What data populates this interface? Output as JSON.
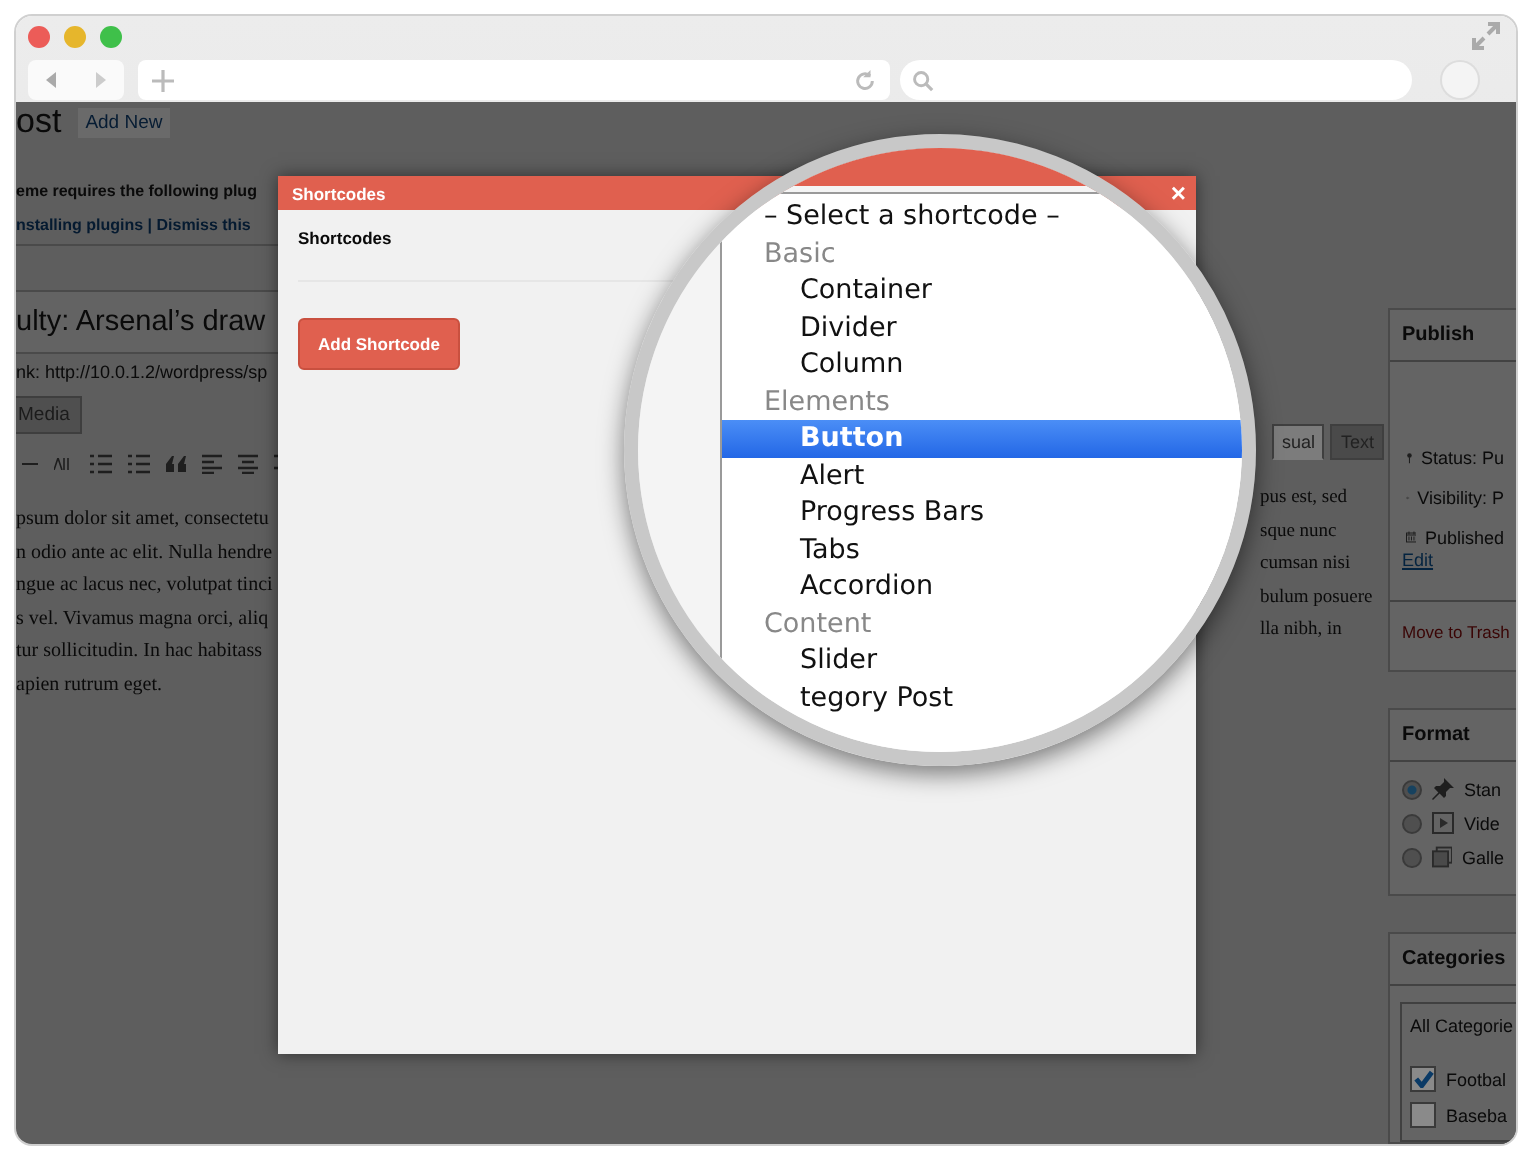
{
  "page": {
    "heading": "ost",
    "add_new": "Add New",
    "notice_lines": [
      {
        "kind": "text",
        "text": "eme requires the following plug"
      },
      {
        "kind": "links",
        "text": "nstalling plugins | Dismiss this"
      }
    ],
    "post_title": "ulty: Arsenal’s draw",
    "permalink": "nk: http://10.0.1.2/wordpress/sp",
    "media_button": "Media",
    "editor_tabs": [
      {
        "label": "sual",
        "selected": true
      },
      {
        "label": "Text",
        "selected": false
      }
    ],
    "body_left": [
      "psum dolor sit amet, consectetu",
      "n odio ante ac elit. Nulla hendre",
      "ngue ac lacus nec, volutpat tinci",
      "s vel. Vivamus magna orci, aliq",
      "tur sollicitudin. In hac habitass",
      "apien rutrum eget."
    ],
    "body_right": [
      "pus est, sed",
      "sque nunc",
      "cumsan nisi",
      "bulum posuere",
      "lla nibh, in"
    ]
  },
  "sidebar": {
    "publish": {
      "title": "Publish",
      "status": "Status: Pu",
      "visibility": "Visibility: P",
      "published": "Published",
      "edit": "Edit",
      "trash": "Move to Trash"
    },
    "format": {
      "title": "Format",
      "options": [
        {
          "label": "Stan",
          "kind": "standard",
          "selected": true
        },
        {
          "label": "Vide",
          "kind": "video",
          "selected": false
        },
        {
          "label": "Galle",
          "kind": "gallery",
          "selected": false
        }
      ]
    },
    "categories": {
      "title": "Categories",
      "tab": "All Categorie",
      "items": [
        {
          "label": "Footbal",
          "checked": true
        },
        {
          "label": "Baseba",
          "checked": false
        }
      ]
    }
  },
  "modal": {
    "title": "Shortcodes",
    "close": "×",
    "field_label": "Shortcodes",
    "button": "Add Shortcode"
  },
  "dropdown": {
    "items": [
      {
        "kind": "placeholder",
        "label": "– Select a shortcode –",
        "selected": false
      },
      {
        "kind": "group",
        "label": "Basic",
        "selected": false
      },
      {
        "kind": "option",
        "label": "Container",
        "selected": false
      },
      {
        "kind": "option",
        "label": "Divider",
        "selected": false
      },
      {
        "kind": "option",
        "label": "Column",
        "selected": false
      },
      {
        "kind": "group",
        "label": "Elements",
        "selected": false
      },
      {
        "kind": "option",
        "label": "Button",
        "selected": true
      },
      {
        "kind": "option",
        "label": "Alert",
        "selected": false
      },
      {
        "kind": "option",
        "label": "Progress Bars",
        "selected": false
      },
      {
        "kind": "option",
        "label": "Tabs",
        "selected": false
      },
      {
        "kind": "option",
        "label": "Accordion",
        "selected": false
      },
      {
        "kind": "group",
        "label": "Content",
        "selected": false
      },
      {
        "kind": "option",
        "label": "Slider",
        "selected": false
      },
      {
        "kind": "option",
        "label": "tegory Post",
        "selected": false
      }
    ]
  }
}
